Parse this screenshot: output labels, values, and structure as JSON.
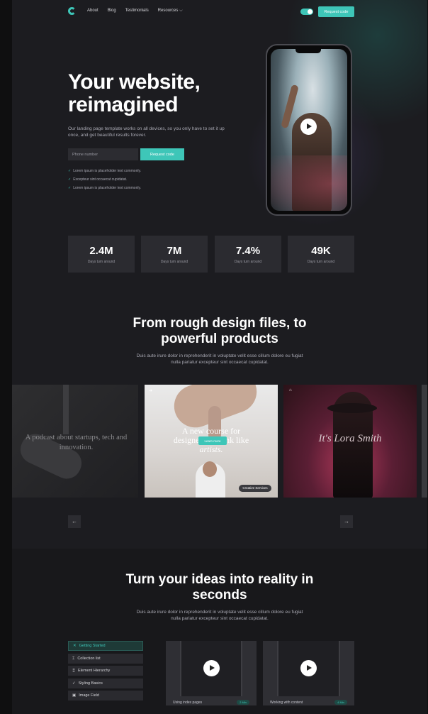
{
  "nav": {
    "items": [
      "About",
      "Blog",
      "Testimonials",
      "Resources ⌵"
    ],
    "cta": "Request code"
  },
  "hero": {
    "title_line1": "Your website,",
    "title_line2": "reimagined",
    "subtitle": "Our landing page template works on all devices, so you only have to set it up once, and get beautiful results forever.",
    "phone_placeholder": "Phone number",
    "cta": "Request code",
    "checks": [
      "Lorem ipsum is placeholder text commonly.",
      "Excepteur sint occaecat cupidatat.",
      "Lorem ipsum is placeholder text commonly."
    ]
  },
  "stats": [
    {
      "value": "2.4M",
      "label": "Days turn around"
    },
    {
      "value": "7M",
      "label": "Days turn around"
    },
    {
      "value": "7.4%",
      "label": "Days turn around"
    },
    {
      "value": "49K",
      "label": "Days turn around"
    }
  ],
  "section2": {
    "title_line1": "From rough design files, to",
    "title_line2": "powerful products",
    "subtitle_line1": "Duis aute irure dolor in reprehenderit in voluptate velit esse cillum dolore eu fugiat",
    "subtitle_line2": "nulla pariatur excepteur sint occaecat cupidatat."
  },
  "carousel": {
    "card1_text": "A podcast about startups, tech and innovation.",
    "card2_line1": "A new course for",
    "card2_line2": "designers to think like",
    "card2_line3": "artists.",
    "card2_button": "Learn more",
    "card2_badge": "Creative Services",
    "card3_text": "It's Lora Smith",
    "prev": "←",
    "next": "→"
  },
  "section3": {
    "title_line1": "Turn your ideas into reality in",
    "title_line2": "seconds",
    "subtitle_line1": "Duis aute irure dolor in reprehenderit in voluptate velit esse cillum dolore eu fugiat",
    "subtitle_line2": "nulla pariatur excepteur sint occaecat cupidatat.",
    "tabs": [
      {
        "icon": "✕",
        "label": "Getting Started"
      },
      {
        "icon": "⌶",
        "label": "Collection list"
      },
      {
        "icon": "⣿",
        "label": "Element Hierarchy"
      },
      {
        "icon": "✓",
        "label": "Styling Basics"
      },
      {
        "icon": "▣",
        "label": "Image Field"
      }
    ],
    "videos": [
      {
        "caption": "Using index pages",
        "length": "2 Min"
      },
      {
        "caption": "Working with content",
        "length": "4 Min"
      }
    ]
  },
  "colors": {
    "accent": "#3ec6b8",
    "background": "#1c1c20",
    "card": "#2b2b30"
  }
}
